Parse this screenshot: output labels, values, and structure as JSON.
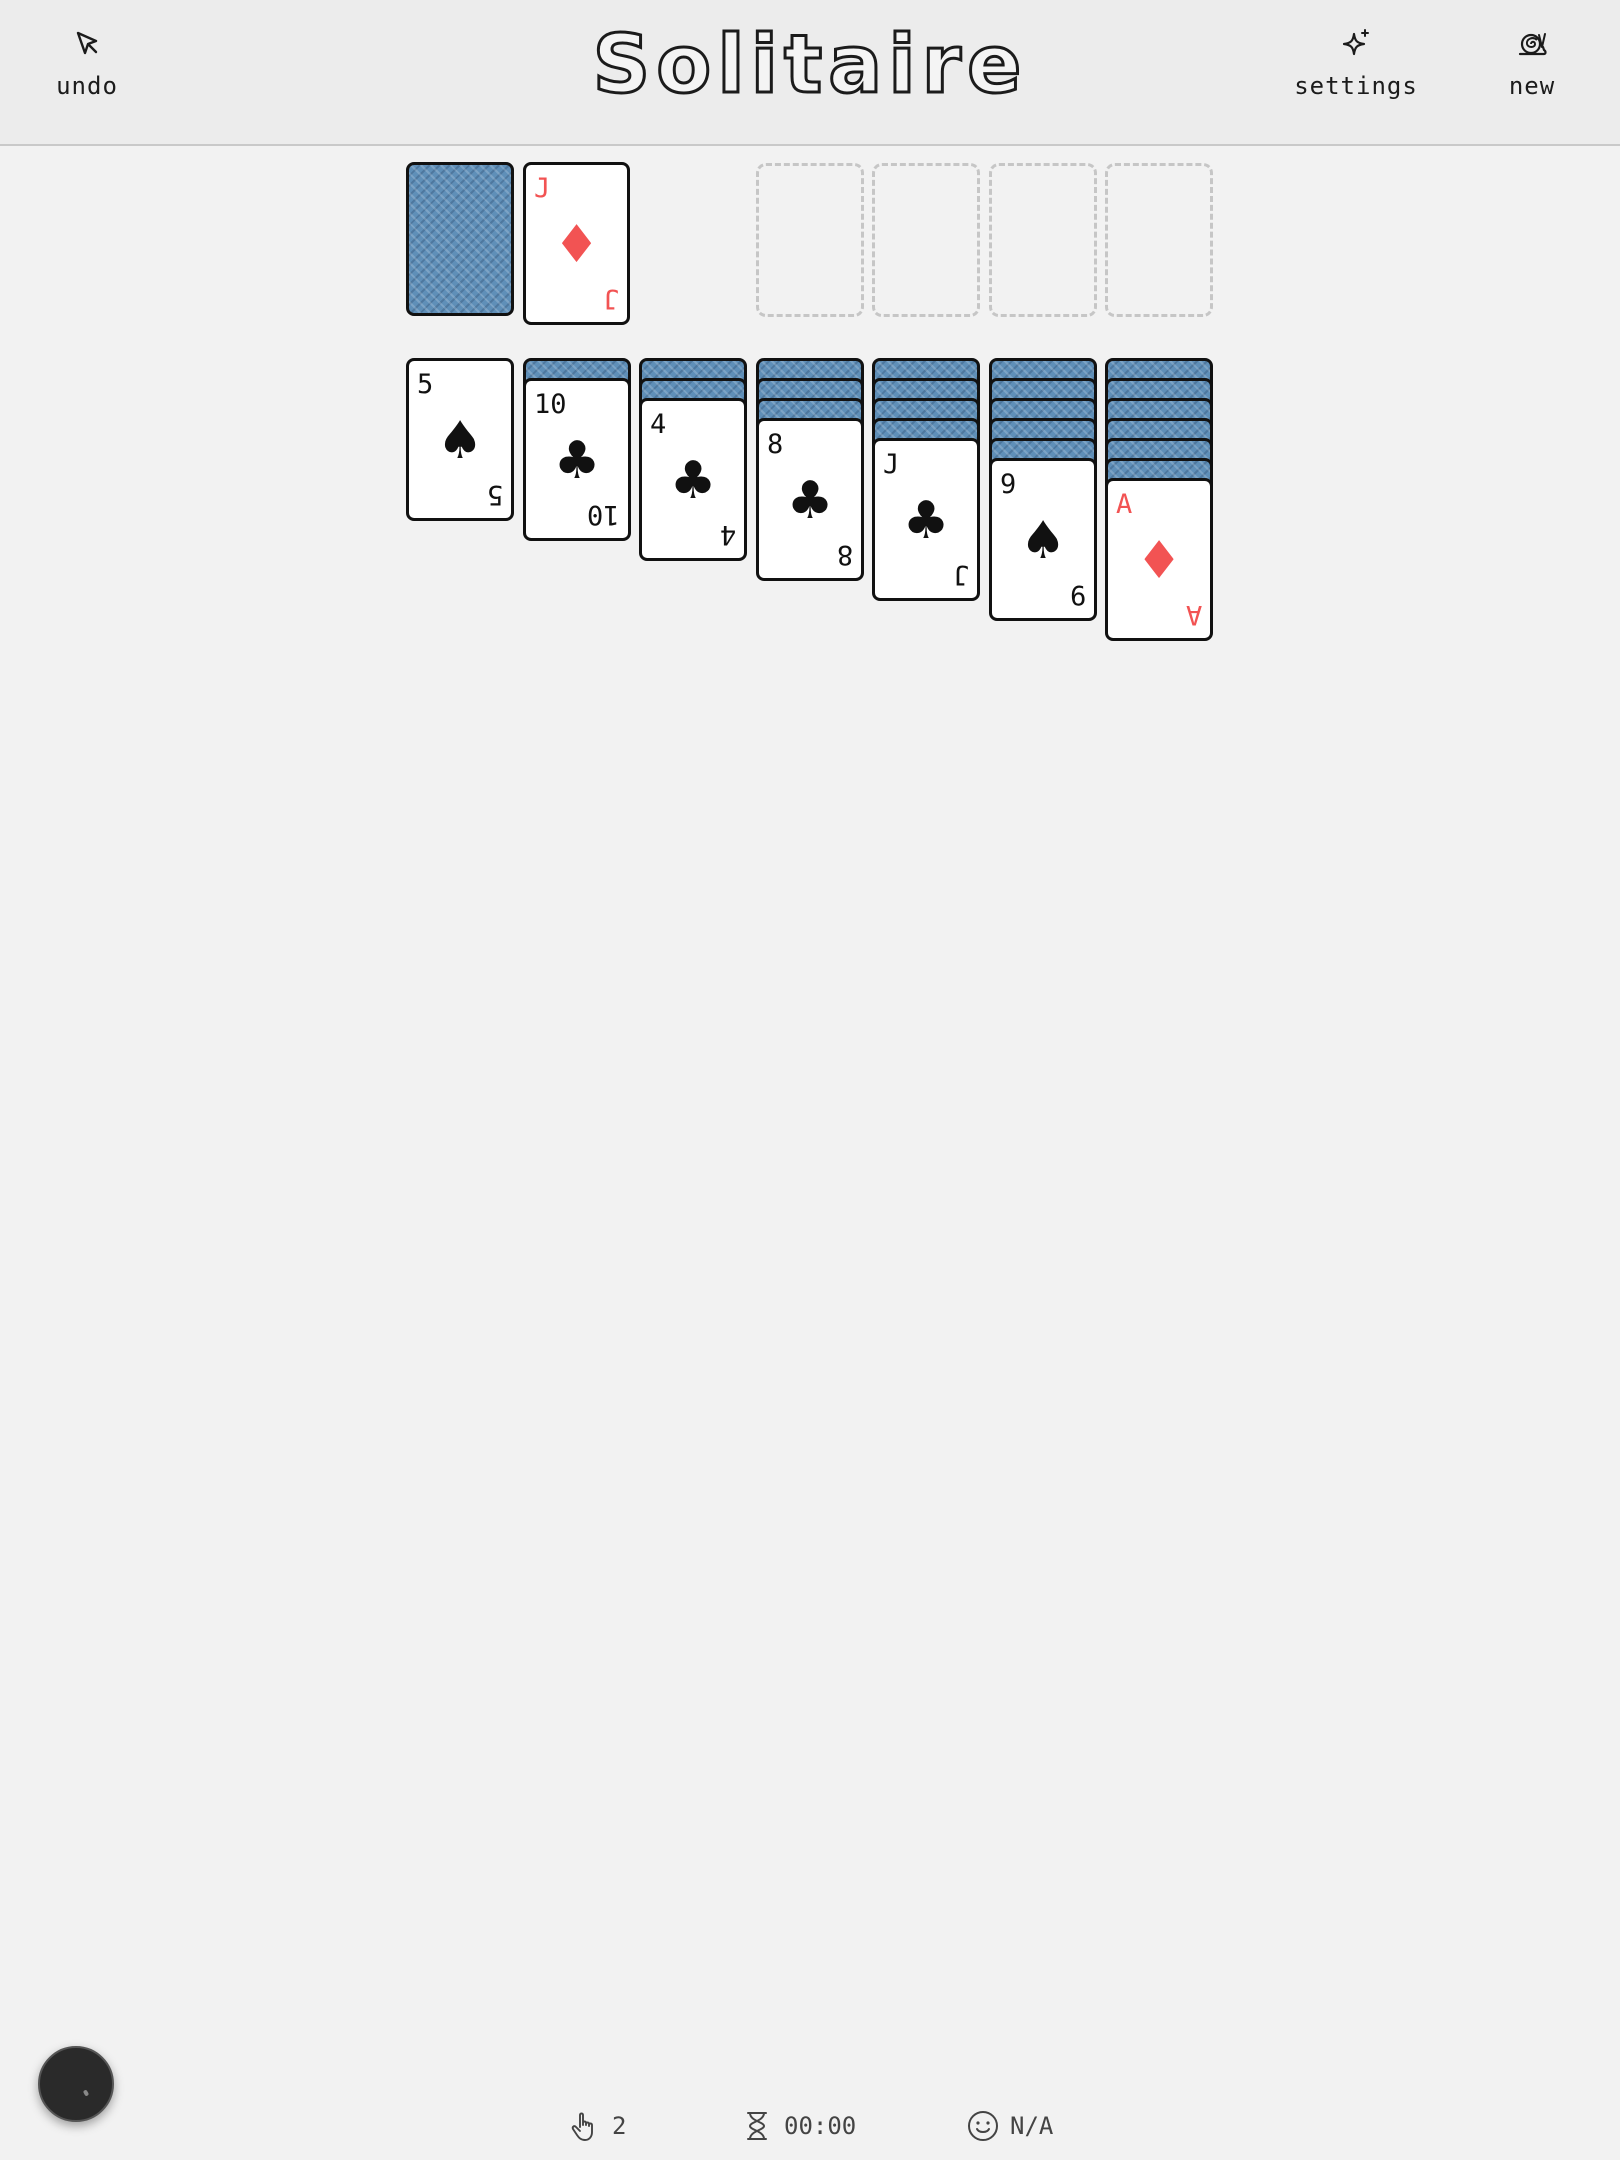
{
  "header": {
    "title": "Solitaire",
    "undo_label": "undo",
    "settings_label": "settings",
    "new_label": "new"
  },
  "waste": {
    "rank": "J",
    "suit": "♦",
    "color": "red"
  },
  "tableau": [
    {
      "hidden": 0,
      "top": {
        "rank": "5",
        "suit": "♠",
        "color": "black"
      }
    },
    {
      "hidden": 1,
      "top": {
        "rank": "10",
        "suit": "♣",
        "color": "black"
      }
    },
    {
      "hidden": 2,
      "top": {
        "rank": "4",
        "suit": "♣",
        "color": "black"
      }
    },
    {
      "hidden": 3,
      "top": {
        "rank": "8",
        "suit": "♣",
        "color": "black"
      }
    },
    {
      "hidden": 4,
      "top": {
        "rank": "J",
        "suit": "♣",
        "color": "black"
      }
    },
    {
      "hidden": 5,
      "top": {
        "rank": "9",
        "suit": "♠",
        "color": "black"
      }
    },
    {
      "hidden": 6,
      "top": {
        "rank": "A",
        "suit": "♦",
        "color": "red"
      }
    }
  ],
  "status": {
    "moves": "2",
    "time": "00:00",
    "score": "N/A"
  },
  "colors": {
    "card_back": "#5f8fb8",
    "red_suit": "#f25353",
    "background": "#f2f2f2"
  }
}
